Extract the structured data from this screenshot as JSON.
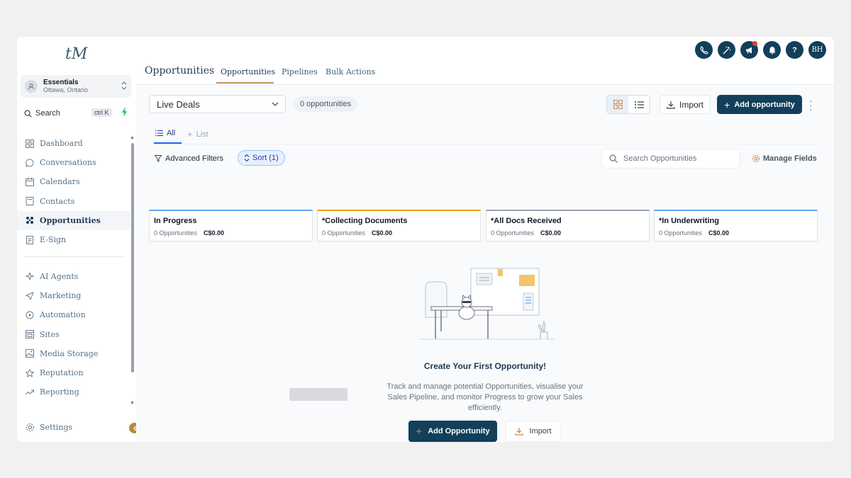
{
  "sidebar": {
    "logo": "tM",
    "location": {
      "name": "Essentials",
      "city": "Ottawa, Ontario"
    },
    "search": {
      "label": "Search",
      "shortcut": "ctrl K"
    },
    "items": [
      {
        "label": "Dashboard",
        "icon": "dashboard-icon"
      },
      {
        "label": "Conversations",
        "icon": "chat-icon"
      },
      {
        "label": "Calendars",
        "icon": "calendar-icon"
      },
      {
        "label": "Contacts",
        "icon": "contacts-icon"
      },
      {
        "label": "Opportunities",
        "icon": "opportunities-icon",
        "active": true
      },
      {
        "label": "E-Sign",
        "icon": "esign-icon"
      }
    ],
    "items2": [
      {
        "label": "AI Agents",
        "icon": "sparkle-icon"
      },
      {
        "label": "Marketing",
        "icon": "send-icon"
      },
      {
        "label": "Automation",
        "icon": "automation-icon"
      },
      {
        "label": "Sites",
        "icon": "sites-icon"
      },
      {
        "label": "Media Storage",
        "icon": "image-icon"
      },
      {
        "label": "Reputation",
        "icon": "star-icon"
      },
      {
        "label": "Reporting",
        "icon": "chart-icon"
      }
    ],
    "settings": "Settings"
  },
  "header": {
    "title": "Opportunities",
    "tabs": [
      "Opportunities",
      "Pipelines",
      "Bulk Actions"
    ],
    "avatar_initials": "BH",
    "help": "?"
  },
  "toolbar": {
    "pipeline": "Live Deals",
    "count": "0 opportunities",
    "import": "Import",
    "add": "Add opportunity"
  },
  "views": {
    "all": "All",
    "list": "List"
  },
  "filters": {
    "advanced": "Advanced Filters",
    "sort": "Sort (1)",
    "search_placeholder": "Search Opportunities",
    "manage": "Manage Fields"
  },
  "stages": [
    {
      "title": "In Progress",
      "count": "0 Opportunities",
      "value": "C$0.00",
      "color": "#60a5fa"
    },
    {
      "title": "*Collecting Documents",
      "count": "0 Opportunities",
      "value": "C$0.00",
      "color": "#f59e0b"
    },
    {
      "title": "*All Docs Received",
      "count": "0 Opportunities",
      "value": "C$0.00",
      "color": "#9ca3af"
    },
    {
      "title": "*In Underwriting",
      "count": "0 Opportunities",
      "value": "C$0.00",
      "color": "#60a5fa"
    }
  ],
  "empty": {
    "title": "Create Your First Opportunity!",
    "description": "Track and manage potential Opportunities, visualise your Sales Pipeline, and monitor Progress to grow your Sales efficiently.",
    "add": "Add Opportunity",
    "import": "Import"
  },
  "colors": {
    "primary": "#123f5a",
    "accent": "#c8915a",
    "notification": "#e53935"
  }
}
